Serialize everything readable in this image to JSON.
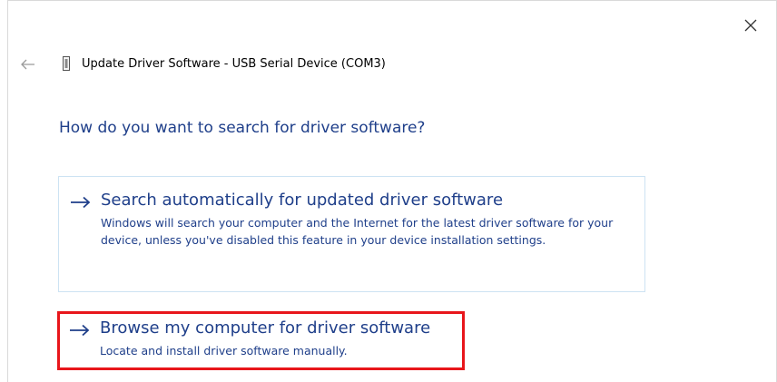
{
  "window": {
    "title": "Update Driver Software - USB Serial Device (COM3)",
    "close_icon": "close-icon",
    "back_icon": "back-arrow-icon",
    "device_icon": "usb-device-icon"
  },
  "heading": "How do you want to search for driver software?",
  "options": [
    {
      "title": "Search automatically for updated driver software",
      "description": "Windows will search your computer and the Internet for the latest driver software for your device, unless you've disabled this feature in your device installation settings.",
      "icon": "arrow-right-icon"
    },
    {
      "title": "Browse my computer for driver software",
      "description": "Locate and install driver software manually.",
      "icon": "arrow-right-icon",
      "highlighted": true
    }
  ],
  "colors": {
    "accent_text": "#1f3f8a",
    "highlight_border": "#e8161b",
    "option_border": "#cde3f3"
  }
}
